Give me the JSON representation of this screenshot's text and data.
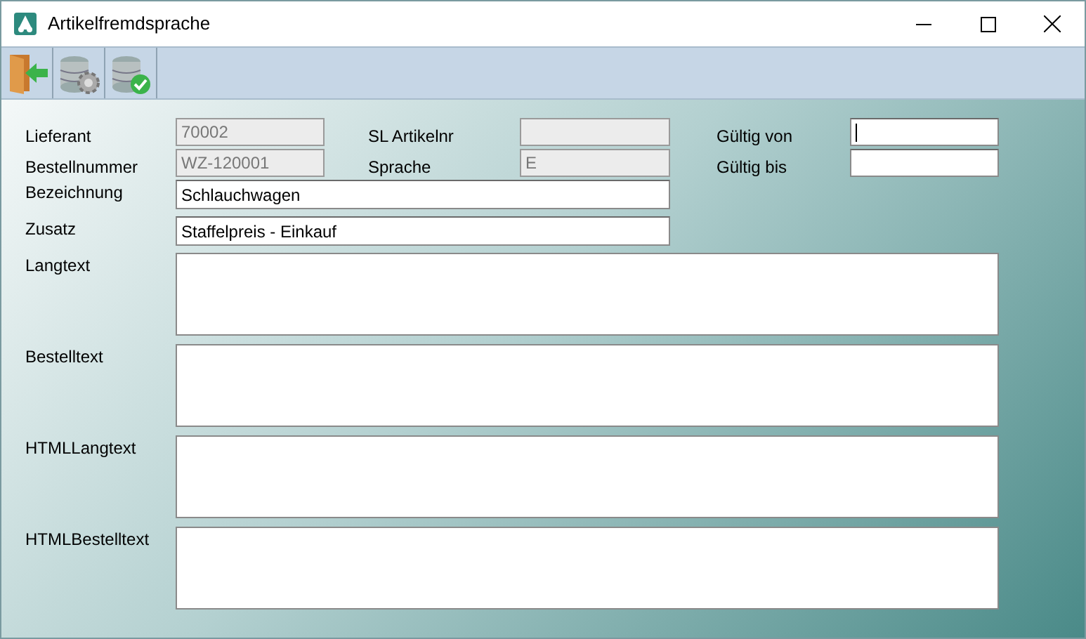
{
  "window": {
    "title": "Artikelfremdsprache"
  },
  "toolbar": [
    {
      "kind": "exit"
    },
    {
      "kind": "db-settings"
    },
    {
      "kind": "db-save"
    }
  ],
  "fields": [
    {
      "label": "Lieferant",
      "value": "70002",
      "disabled": true,
      "kind": "line"
    },
    {
      "label": "SL Artikelnr",
      "disabled": true,
      "kind": "line"
    },
    {
      "label": "Gültig von",
      "disabled": false,
      "focused": true,
      "kind": "line"
    },
    {
      "label": "Bestellnummer",
      "value": "WZ-120001",
      "disabled": true,
      "kind": "line"
    },
    {
      "label": "Sprache",
      "value": "E",
      "disabled": true,
      "kind": "line"
    },
    {
      "label": "Gültig bis",
      "disabled": false,
      "kind": "line"
    },
    {
      "label": "Bezeichnung",
      "value": "Schlauchwagen",
      "disabled": false,
      "kind": "wide"
    },
    {
      "label": "Zusatz",
      "value": "Staffelpreis - Einkauf",
      "disabled": false,
      "kind": "wide"
    },
    {
      "label": "Langtext",
      "disabled": false,
      "kind": "area"
    },
    {
      "label": "Bestelltext",
      "disabled": false,
      "kind": "area"
    },
    {
      "label": "HTMLLangtext",
      "disabled": false,
      "kind": "area"
    },
    {
      "label": "HTMLBestelltext",
      "disabled": false,
      "kind": "area"
    }
  ]
}
